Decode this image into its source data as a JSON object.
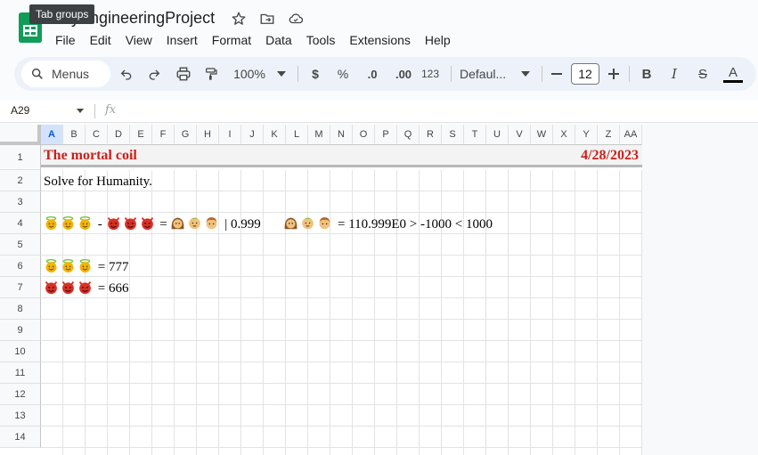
{
  "app": {
    "title": "…yEngineeringProject",
    "tooltip": "Tab groups",
    "menu": [
      "File",
      "Edit",
      "View",
      "Insert",
      "Format",
      "Data",
      "Tools",
      "Extensions",
      "Help"
    ]
  },
  "toolbar": {
    "menus_label": "Menus",
    "zoom": "100%",
    "currency": "$",
    "percent": "%",
    "decrease_decimal": ".0",
    "increase_decimal": ".00",
    "number_format": "123",
    "font": "Defaul...",
    "font_size": "12",
    "bold": "B",
    "italic": "I",
    "strike": "S",
    "text_color": "A",
    "text_color_value": "#000000"
  },
  "formula_bar": {
    "name_box": "A29",
    "fx": "fx"
  },
  "grid": {
    "columns": [
      "A",
      "B",
      "C",
      "D",
      "E",
      "F",
      "G",
      "H",
      "I",
      "J",
      "K",
      "L",
      "M",
      "N",
      "O",
      "P",
      "Q",
      "R",
      "S",
      "T",
      "U",
      "V",
      "W",
      "X",
      "Y",
      "Z",
      "AA"
    ],
    "selected_column": "A",
    "rows": [
      "1",
      "2",
      "3",
      "4",
      "5",
      "6",
      "7",
      "8",
      "9",
      "10",
      "11",
      "12",
      "13",
      "14"
    ]
  },
  "cells": {
    "title": "The mortal coil",
    "date": "4/28/2023",
    "a2": "Solve for Humanity.",
    "a4_minus": "-",
    "a4_equals": "=",
    "a4_mid": "| 0.999",
    "a4_end": "= 110.999E0  > -1000 < 1000",
    "a6_text": "= 777",
    "a7_text": "= 666"
  },
  "colors": {
    "accent_red": "#cc1f1a",
    "selected_header": "#d3e3fd",
    "sheets_green": "#0f9d58"
  }
}
